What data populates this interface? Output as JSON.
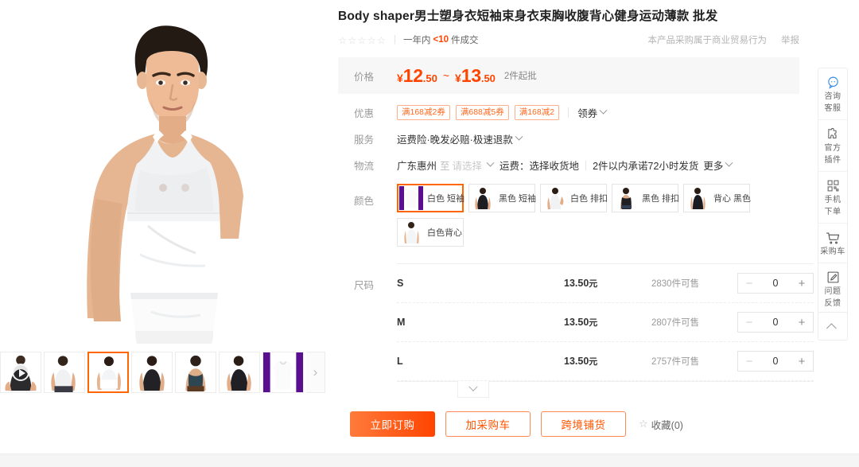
{
  "product": {
    "title": "Body shaper男士塑身衣短袖束身衣束胸收腹背心健身运动薄款 批发",
    "rating_stars": "☆☆☆☆☆",
    "deal_period": "一年内",
    "deal_count": "<10",
    "deal_suffix": "件成交",
    "business_notice": "本产品采购属于商业贸易行为",
    "report_label": "举报"
  },
  "price": {
    "label": "价格",
    "currency": "¥",
    "low_int": "12",
    "low_dec": ".50",
    "range_sep": "~",
    "high_int": "13",
    "high_dec": ".50",
    "moq": "2件起批"
  },
  "promo": {
    "label": "优惠",
    "coupons": [
      "满168减2券",
      "满688减5券",
      "满168减2"
    ],
    "get_coupon_label": "领券"
  },
  "service": {
    "label": "服务",
    "text": "运费险·晚发必赔·极速退款"
  },
  "logistics": {
    "label": "物流",
    "from": "广东惠州",
    "to_label": "至",
    "to_placeholder": "请选择",
    "freight": "运费：选择收货地",
    "promise": "2件以内承诺72小时发货",
    "more_label": "更多"
  },
  "color": {
    "label": "颜色",
    "options": [
      {
        "name": "白色 短袖",
        "selected": true,
        "img": "white-short-sleeve"
      },
      {
        "name": "黑色 短袖",
        "selected": false,
        "img": "black-short-sleeve"
      },
      {
        "name": "白色 排扣",
        "selected": false,
        "img": "white-buttoned"
      },
      {
        "name": "黑色 排扣",
        "selected": false,
        "img": "black-buttoned"
      },
      {
        "name": "背心 黑色",
        "selected": false,
        "img": "black-vest"
      },
      {
        "name": "白色背心",
        "selected": false,
        "img": "white-vest"
      }
    ]
  },
  "size": {
    "label": "尺码",
    "rows": [
      {
        "name": "S",
        "price": "13.50",
        "unit": "元",
        "stock": "2830件可售",
        "qty": "0"
      },
      {
        "name": "M",
        "price": "13.50",
        "unit": "元",
        "stock": "2807件可售",
        "qty": "0"
      },
      {
        "name": "L",
        "price": "13.50",
        "unit": "元",
        "stock": "2757件可售",
        "qty": "0"
      }
    ],
    "minus_label": "−",
    "plus_label": "+"
  },
  "actions": {
    "buy_now": "立即订购",
    "add_cart": "加采购车",
    "cross_border": "跨境铺货",
    "favorite": "收藏(0)",
    "favorite_icon": "star-outline-icon"
  },
  "gallery": {
    "thumbnails": [
      {
        "kind": "video",
        "icon": "play-icon",
        "selected": false
      },
      {
        "kind": "image",
        "selected": false
      },
      {
        "kind": "image",
        "selected": true
      },
      {
        "kind": "image",
        "selected": false
      },
      {
        "kind": "image",
        "selected": false
      },
      {
        "kind": "image",
        "selected": false
      },
      {
        "kind": "image",
        "selected": false
      }
    ],
    "next_arrow": "›"
  },
  "rail": {
    "items": [
      {
        "icon": "chat-service-icon",
        "line1": "咨询",
        "line2": "客服"
      },
      {
        "icon": "puzzle-plugin-icon",
        "line1": "官方",
        "line2": "插件"
      },
      {
        "icon": "qrcode-icon",
        "line1": "手机",
        "line2": "下单"
      },
      {
        "icon": "shopping-cart-icon",
        "line1": "采购车",
        "line2": ""
      },
      {
        "icon": "feedback-pencil-icon",
        "line1": "问题",
        "line2": "反馈"
      }
    ],
    "back_to_top_icon": "chevron-up-icon"
  },
  "colors": {
    "accent_orange": "#ff4400",
    "coupon_border": "#ffb08a",
    "selected_border": "#ff6600",
    "price_bg": "#f7f7f7"
  }
}
